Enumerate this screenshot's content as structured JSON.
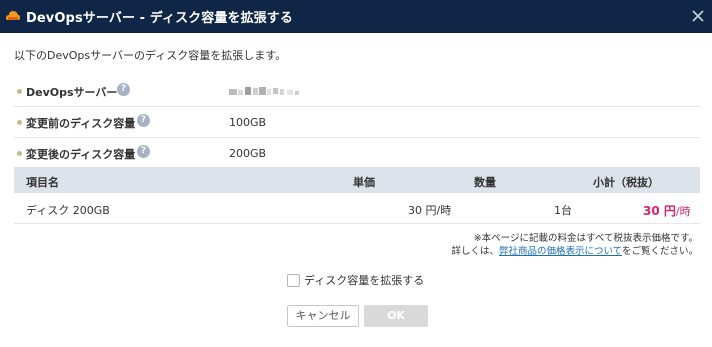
{
  "dialog": {
    "title": "DevOpsサーバー - ディスク容量を拡張する",
    "intro": "以下のDevOpsサーバーのディスク容量を拡張します。"
  },
  "info": {
    "server_label": "DevOpsサーバー",
    "before_label": "変更前のディスク容量",
    "before_value": "100GB",
    "after_label": "変更後のディスク容量",
    "after_value": "200GB",
    "help_glyph": "?"
  },
  "table": {
    "headers": {
      "item": "項目名",
      "unit_price": "単価",
      "quantity": "数量",
      "subtotal": "小計（税抜）"
    },
    "rows": [
      {
        "item": "ディスク 200GB",
        "unit_price": "30 円/時",
        "quantity": "1台",
        "subtotal_amount": "30 円",
        "subtotal_unit": "/時"
      }
    ]
  },
  "notes": {
    "line1": "※本ページに記載の料金はすべて税抜表示価格です。",
    "line2_prefix": "詳しくは、",
    "line2_link": "弊社商品の価格表示について",
    "line2_suffix": "をご覧ください。"
  },
  "confirm": {
    "label": "ディスク容量を拡張する",
    "checked": false
  },
  "buttons": {
    "cancel": "キャンセル",
    "ok": "OK"
  },
  "colors": {
    "titlebar": "#0f2646",
    "price": "#d6256e",
    "link": "#1a6fb5",
    "table_header": "#dde3ea"
  },
  "icons": {
    "logo": "orange-cloud-icon",
    "close": "close-icon",
    "help": "help-icon"
  }
}
